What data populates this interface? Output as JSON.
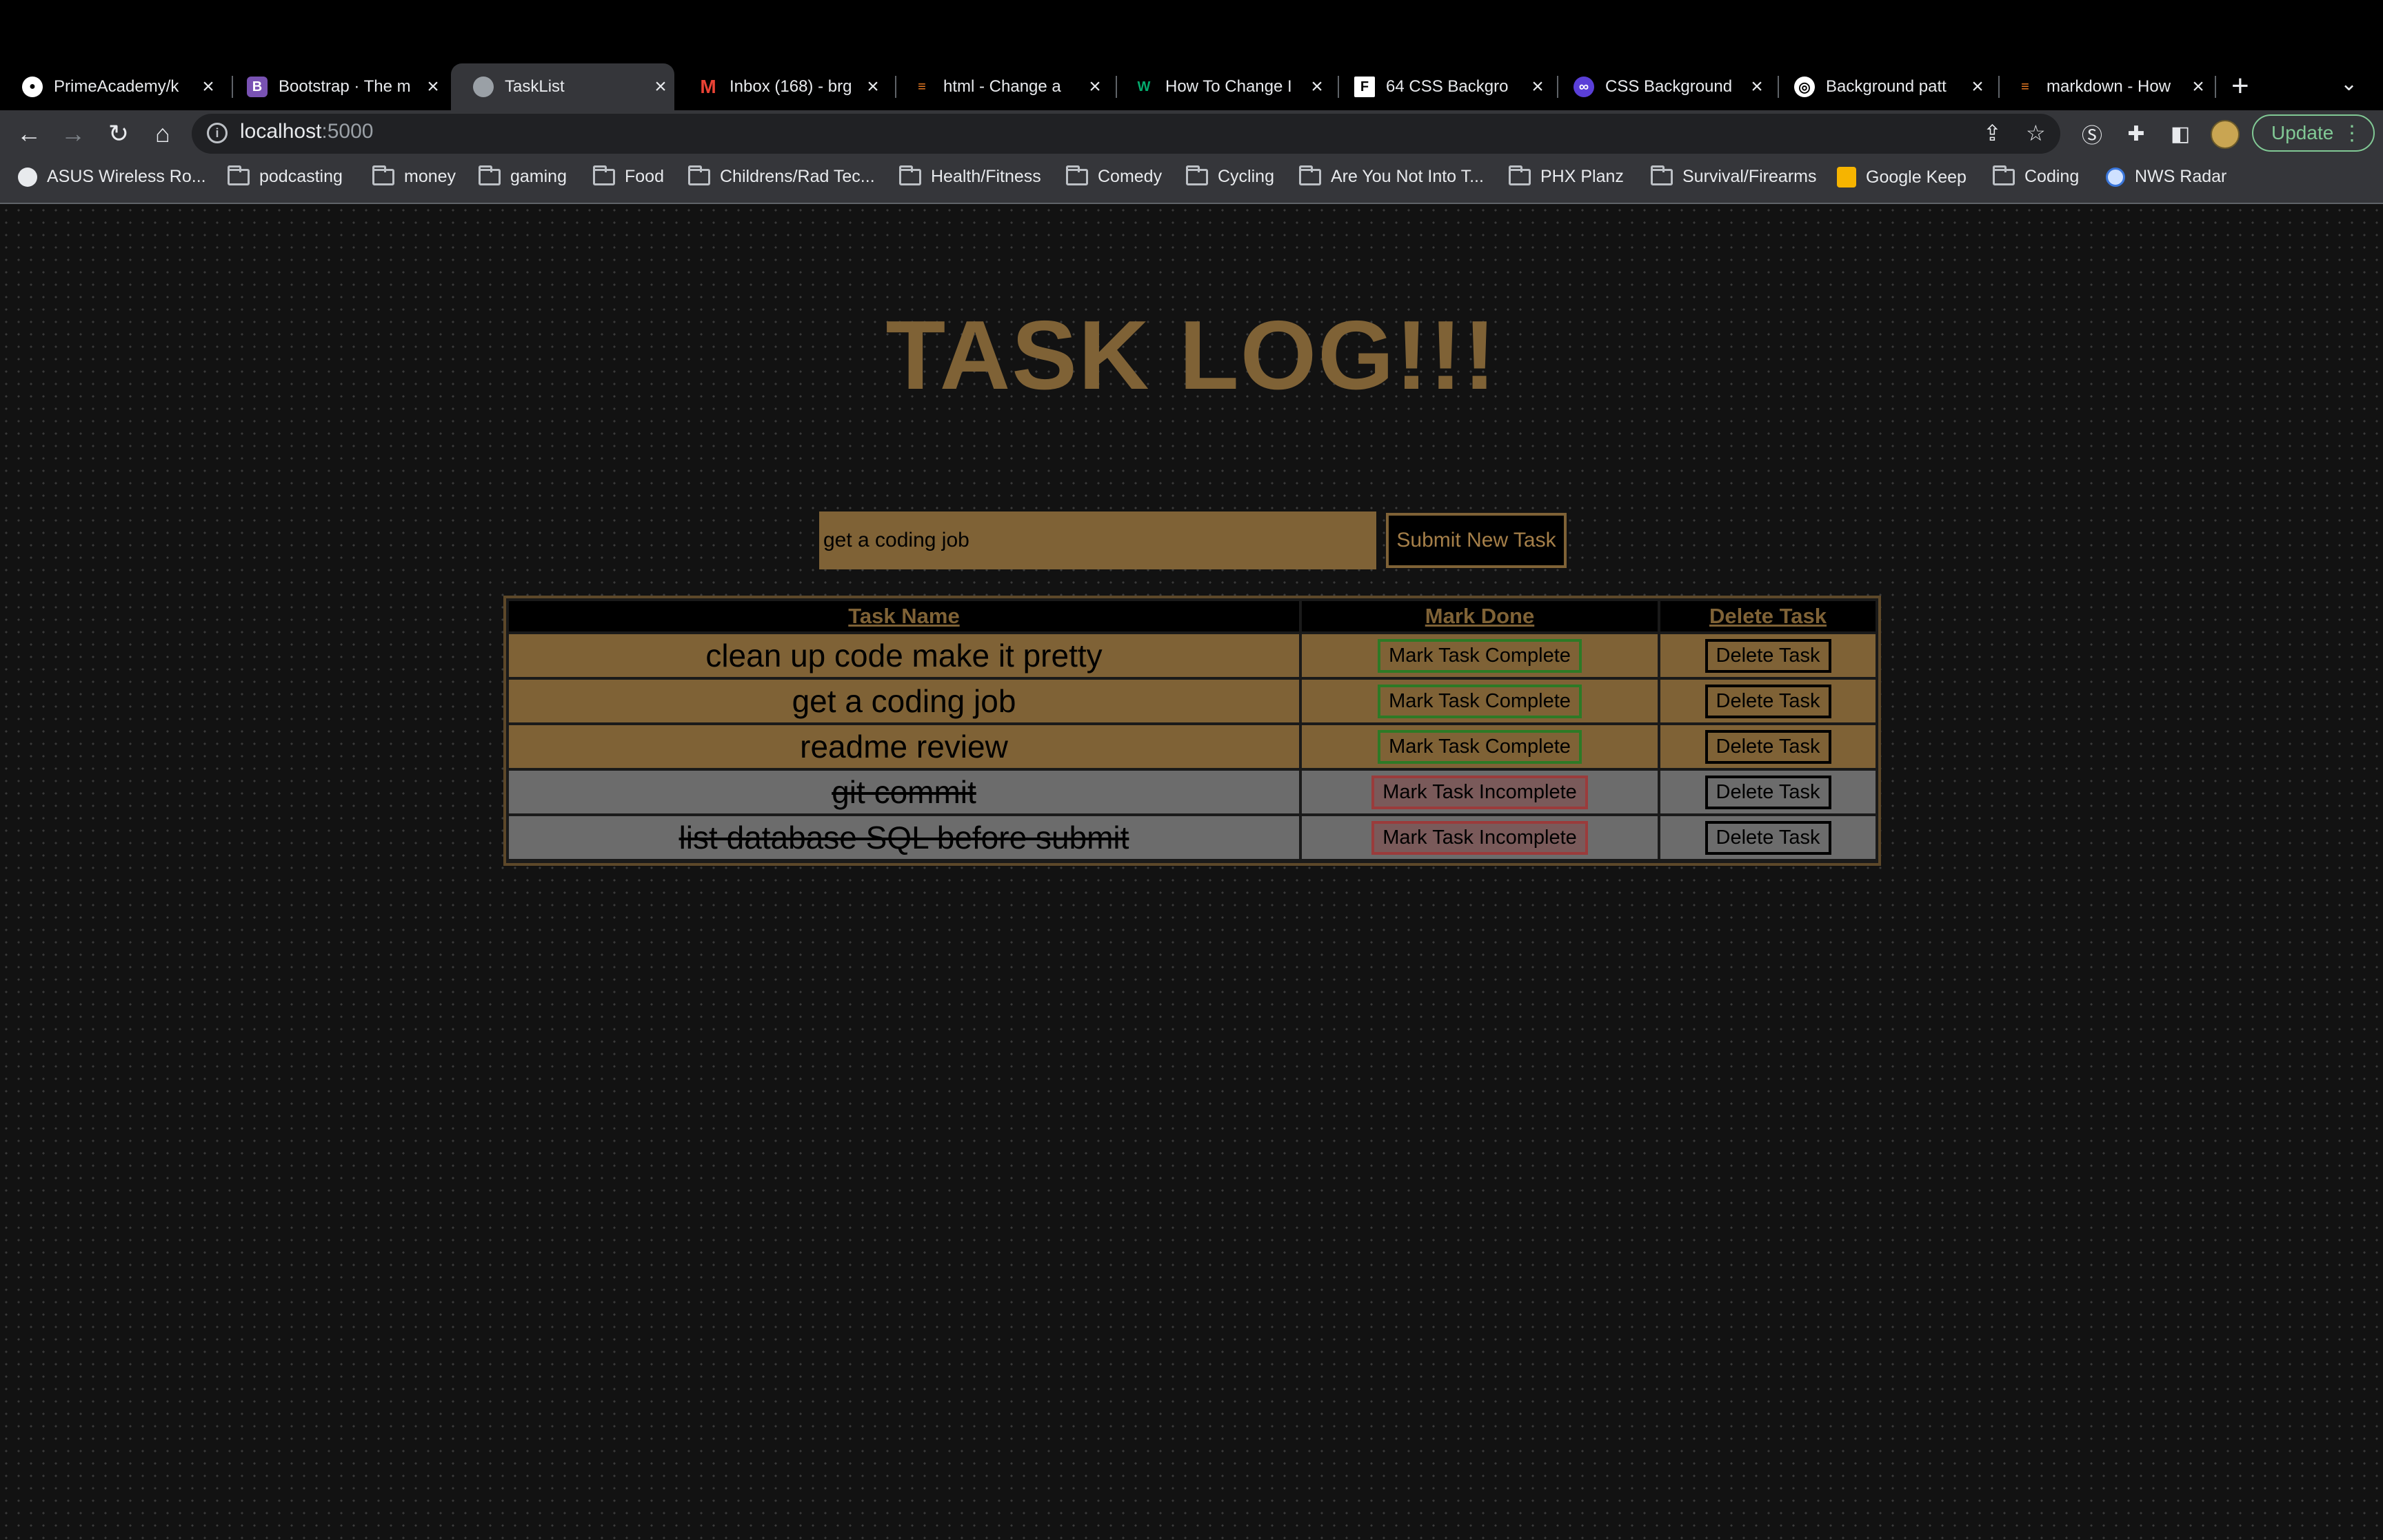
{
  "browser": {
    "tabs": [
      {
        "title": "PrimeAcademy/k",
        "icon": "github-icon",
        "active": false
      },
      {
        "title": "Bootstrap · The m",
        "icon": "bootstrap-icon",
        "active": false
      },
      {
        "title": "TaskList",
        "icon": "globe-icon",
        "active": true
      },
      {
        "title": "Inbox (168) - brg",
        "icon": "gmail-icon",
        "active": false
      },
      {
        "title": "html - Change a",
        "icon": "stackoverflow-icon",
        "active": false
      },
      {
        "title": "How To Change I",
        "icon": "w3-icon",
        "active": false
      },
      {
        "title": "64 CSS Backgro",
        "icon": "frontend-icon",
        "active": false
      },
      {
        "title": "CSS Background",
        "icon": "css-icon",
        "active": false
      },
      {
        "title": "Background patt",
        "icon": "pattern-icon",
        "active": false
      },
      {
        "title": "markdown - How",
        "icon": "stackoverflow-icon",
        "active": false
      }
    ],
    "url_host": "localhost",
    "url_port": ":5000",
    "update_label": "Update",
    "bookmarks": [
      {
        "label": "ASUS Wireless Ro...",
        "icon": "globe-icon"
      },
      {
        "label": "podcasting",
        "icon": "folder-icon"
      },
      {
        "label": "money",
        "icon": "folder-icon"
      },
      {
        "label": "gaming",
        "icon": "folder-icon"
      },
      {
        "label": "Food",
        "icon": "folder-icon"
      },
      {
        "label": "Childrens/Rad Tec...",
        "icon": "folder-icon"
      },
      {
        "label": "Health/Fitness",
        "icon": "folder-icon"
      },
      {
        "label": "Comedy",
        "icon": "folder-icon"
      },
      {
        "label": "Cycling",
        "icon": "folder-icon"
      },
      {
        "label": "Are You Not Into T...",
        "icon": "folder-icon"
      },
      {
        "label": "PHX Planz",
        "icon": "folder-icon"
      },
      {
        "label": "Survival/Firearms",
        "icon": "folder-icon"
      },
      {
        "label": "Google Keep",
        "icon": "keep-icon"
      },
      {
        "label": "Coding",
        "icon": "folder-icon"
      },
      {
        "label": "NWS Radar",
        "icon": "nws-icon"
      }
    ]
  },
  "page": {
    "title": "TASK LOG!!!",
    "input_value": "get a coding job",
    "submit_label": "Submit New Task",
    "table": {
      "headers": [
        "Task Name",
        "Mark Done",
        "Delete Task"
      ],
      "rows": [
        {
          "name": "clean up code make it pretty",
          "done": false,
          "action": "Mark Task Complete",
          "delete": "Delete Task"
        },
        {
          "name": "get a coding job",
          "done": false,
          "action": "Mark Task Complete",
          "delete": "Delete Task"
        },
        {
          "name": "readme review",
          "done": false,
          "action": "Mark Task Complete",
          "delete": "Delete Task"
        },
        {
          "name": "git commit",
          "done": true,
          "action": "Mark Task Incomplete",
          "delete": "Delete Task"
        },
        {
          "name": "list database SQL before submit",
          "done": true,
          "action": "Mark Task Incomplete",
          "delete": "Delete Task"
        }
      ]
    }
  },
  "colors": {
    "accent": "#7f6236",
    "done_row": "#6c6c6c",
    "complete_border": "#2d7a26",
    "incomplete_border": "#9b3b3b"
  }
}
